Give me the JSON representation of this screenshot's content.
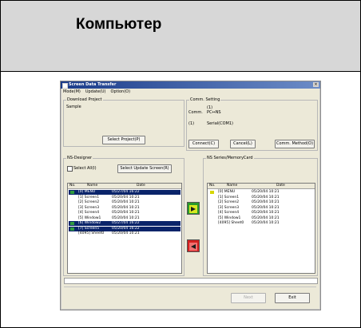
{
  "header": {
    "title": "Компьютер"
  },
  "window": {
    "title": "Screen Data Transfer",
    "close": "×",
    "menu": [
      "Mode(M)",
      "Update(U)",
      "Option(O)"
    ]
  },
  "download_project": {
    "label": "Download Project",
    "value": "Sample",
    "select_button": "Select Project(P)"
  },
  "comm": {
    "label": "Comm. Setting",
    "row1_key": "(1)",
    "row2_key": "Comm.",
    "row2_val": "PC↔NS",
    "row3_key": "(1)",
    "row3_val": "Serial(COM1)",
    "connect_button": "Connect(C)",
    "cancel_button": "Cancel(L)",
    "method_button": "Comm. Method(O)"
  },
  "ns_designer": {
    "label": "NS-Designer",
    "select_all": "Select All(I)",
    "select_update_button": "Select Update Screen(R)",
    "columns": [
      "No.",
      "Name",
      "Date"
    ],
    "rows": [
      {
        "name": "[0] MENU",
        "date": "05/27/04 16:22",
        "selected": true,
        "icon": "#2e9a3e"
      },
      {
        "name": "[1] Screen1",
        "date": "05/20/04 10:21",
        "selected": false
      },
      {
        "name": "[2] Screen2",
        "date": "05/20/04 10:21",
        "selected": false
      },
      {
        "name": "[3] Screen3",
        "date": "05/20/04 10:21",
        "selected": false
      },
      {
        "name": "[4] Screen4",
        "date": "05/20/04 10:21",
        "selected": false
      },
      {
        "name": "[5] Window1",
        "date": "05/20/04 10:21",
        "selected": false
      },
      {
        "name": "[6] Window2",
        "date": "05/27/04 16:22",
        "selected": true,
        "icon": "#2e9a3e"
      },
      {
        "name": "[7] Screen5",
        "date": "05/20/04 16:22",
        "selected": true,
        "icon": "#2e9a3e"
      },
      {
        "name": "[4095] Sheet0",
        "date": "05/20/04 10:21",
        "selected": false
      }
    ]
  },
  "ns_series": {
    "label": "NS Series/MemoryCard",
    "columns": [
      "No.",
      "Name",
      "Date"
    ],
    "rows": [
      {
        "name": "[0] MENU",
        "date": "05/20/04 10:21",
        "icon": "#d6d600"
      },
      {
        "name": "[1] Screen1",
        "date": "05/20/04 10:21"
      },
      {
        "name": "[2] Screen2",
        "date": "05/20/04 10:21"
      },
      {
        "name": "[3] Screen3",
        "date": "05/20/04 10:21"
      },
      {
        "name": "[4] Screen4",
        "date": "05/20/04 10:21"
      },
      {
        "name": "[5] Window1",
        "date": "05/20/04 10:21"
      },
      {
        "name": "[4095] Sheet0",
        "date": "05/20/04 10:21"
      }
    ]
  },
  "bottom": {
    "next_button": "Next",
    "exit_button": "Exit"
  },
  "colors": {
    "download_arrow": "#2a9a2a",
    "upload_arrow": "#d32020",
    "selection": "#0a246a"
  }
}
